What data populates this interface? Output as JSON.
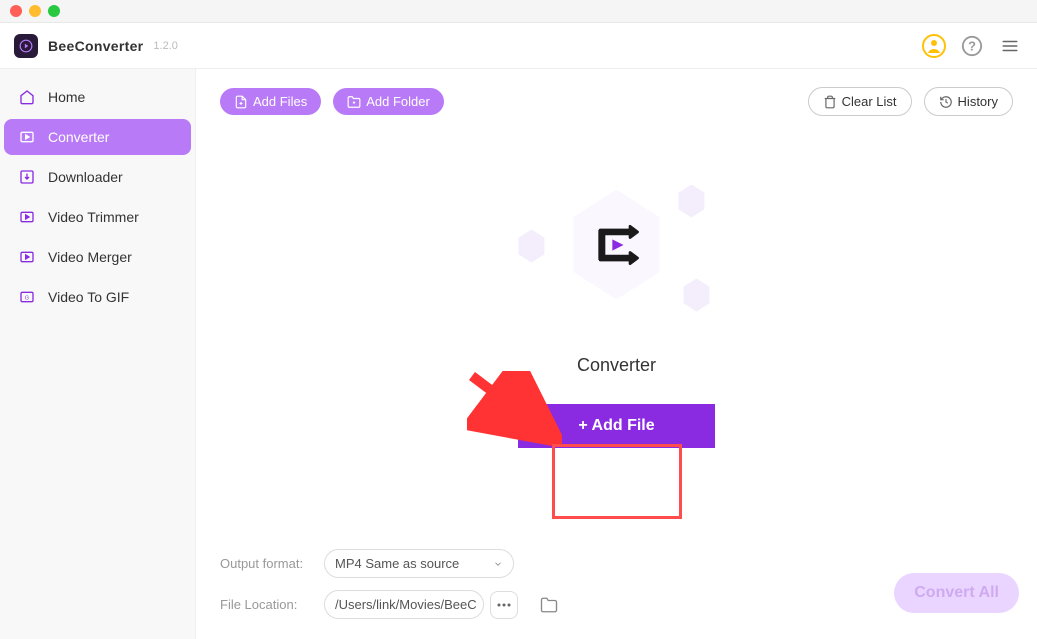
{
  "app": {
    "name": "BeeConverter",
    "version": "1.2.0"
  },
  "sidebar": {
    "items": [
      {
        "label": "Home",
        "icon": "home"
      },
      {
        "label": "Converter",
        "icon": "converter",
        "active": true
      },
      {
        "label": "Downloader",
        "icon": "download"
      },
      {
        "label": "Video Trimmer",
        "icon": "trim"
      },
      {
        "label": "Video Merger",
        "icon": "merge"
      },
      {
        "label": "Video To GIF",
        "icon": "gif"
      }
    ]
  },
  "toolbar": {
    "add_files": "Add Files",
    "add_folder": "Add Folder",
    "clear_list": "Clear List",
    "history": "History"
  },
  "drop": {
    "title": "Converter",
    "button": "+ Add File"
  },
  "footer": {
    "output_label": "Output format:",
    "output_value": "MP4 Same as source",
    "location_label": "File Location:",
    "location_value": "/Users/link/Movies/BeeC",
    "convert_all": "Convert All"
  }
}
